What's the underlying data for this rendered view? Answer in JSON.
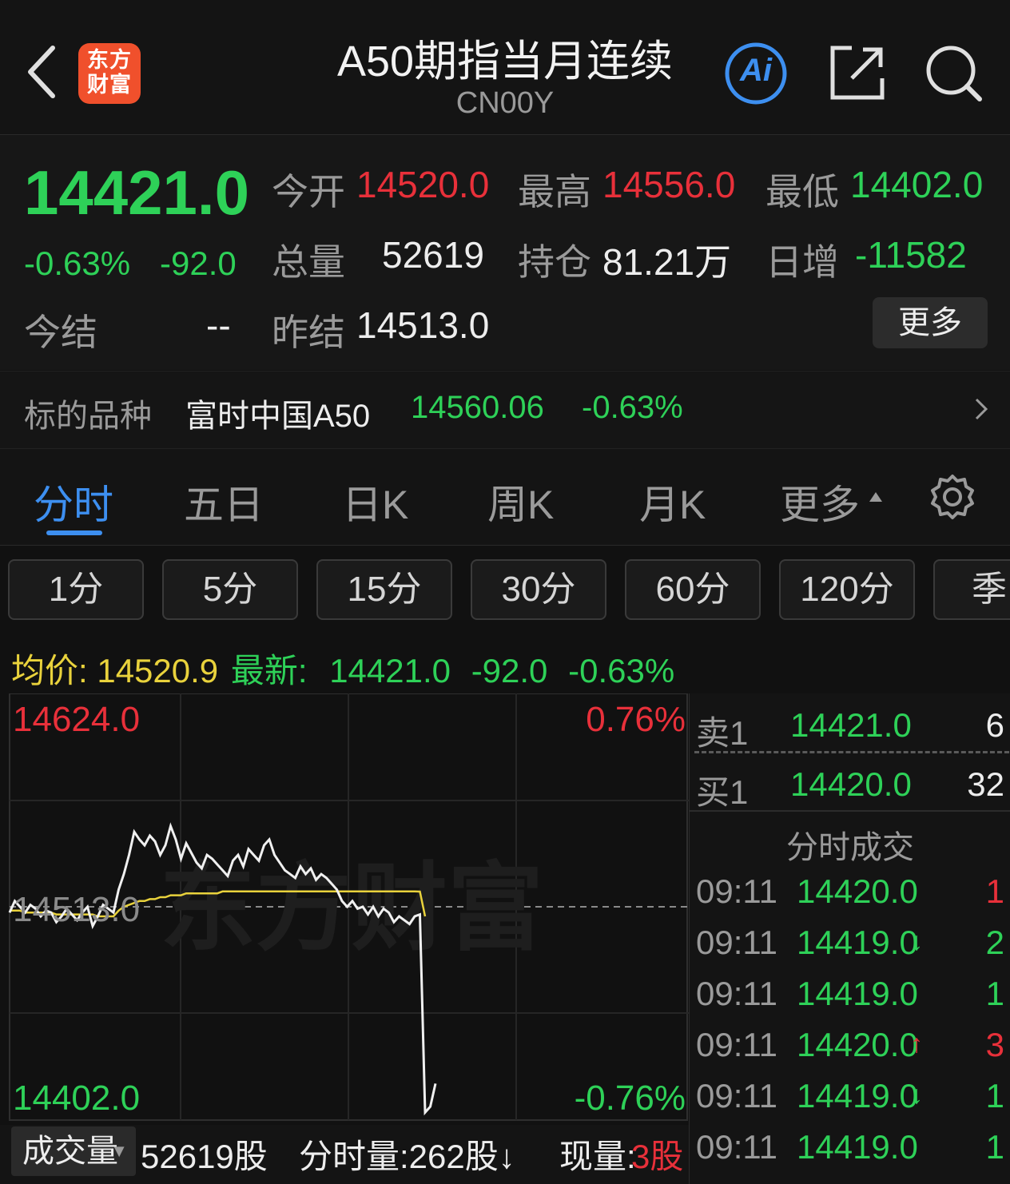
{
  "header": {
    "back": "‹",
    "logo_text": "东方财富",
    "title": "A50期指当月连续",
    "code": "CN00Y",
    "ai_label": "Ai"
  },
  "quote": {
    "last": "14421.0",
    "change_pct": "-0.63%",
    "change": "-92.0",
    "open_label": "今开",
    "open": "14520.0",
    "high_label": "最高",
    "high": "14556.0",
    "low_label": "最低",
    "low": "14402.0",
    "volume_label": "总量",
    "volume": "52619",
    "oi_label": "持仓",
    "oi": "81.21万",
    "oi_change_label": "日增",
    "oi_change": "-11582",
    "settle_label": "今结",
    "settle": "--",
    "prev_settle_label": "昨结",
    "prev_settle": "14513.0",
    "more": "更多"
  },
  "underlying": {
    "label": "标的品种",
    "name": "富时中国A50",
    "price": "14560.06",
    "change_pct": "-0.63%"
  },
  "tabs": [
    "分时",
    "五日",
    "日K",
    "周K",
    "月K",
    "更多"
  ],
  "periods": [
    "1分",
    "5分",
    "15分",
    "30分",
    "60分",
    "120分",
    "季"
  ],
  "infoline": {
    "avg_label": "均价:",
    "avg": "14520.9",
    "latest_label": "最新:",
    "latest": "14421.0",
    "change": "-92.0",
    "change_pct": "-0.63%"
  },
  "chart_data": {
    "type": "line",
    "y_max_label": "14624.0",
    "y_min_label": "14402.0",
    "y_prev_label": "14513.0",
    "pct_max_label": "0.76%",
    "pct_min_label": "-0.76%",
    "watermark": "东方财富",
    "ylim": [
      14402.0,
      14624.0
    ],
    "prev_close": 14513.0,
    "price": [
      14510,
      14516,
      14513,
      14510,
      14514,
      14512,
      14508,
      14511,
      14510,
      14505,
      14508,
      14512,
      14509,
      14506,
      14510,
      14513,
      14503,
      14508,
      14514,
      14512,
      14510,
      14522,
      14530,
      14540,
      14552,
      14548,
      14545,
      14550,
      14547,
      14540,
      14545,
      14555,
      14548,
      14538,
      14546,
      14541,
      14536,
      14533,
      14540,
      14538,
      14535,
      14532,
      14529,
      14537,
      14540,
      14534,
      14543,
      14540,
      14537,
      14545,
      14548,
      14540,
      14536,
      14532,
      14530,
      14528,
      14534,
      14530,
      14533,
      14527,
      14530,
      14528,
      14525,
      14522,
      14516,
      14513,
      14516,
      14512,
      14513,
      14509,
      14513,
      14508,
      14512,
      14510,
      14505,
      14508,
      14506,
      14504,
      14508,
      14509,
      14406,
      14409,
      14421
    ],
    "avg": [
      14511,
      14511,
      14511,
      14510,
      14510,
      14510,
      14510,
      14510,
      14510,
      14509,
      14509,
      14509,
      14509,
      14509,
      14509,
      14509,
      14509,
      14508,
      14508,
      14508,
      14508,
      14511,
      14513,
      14514,
      14515,
      14516,
      14516,
      14517,
      14517,
      14518,
      14518,
      14519,
      14519,
      14519,
      14520,
      14520,
      14520,
      14520,
      14520,
      14520,
      14520,
      14521,
      14521,
      14521,
      14521,
      14521,
      14521,
      14521,
      14521,
      14521,
      14521,
      14521,
      14521,
      14521,
      14521,
      14521,
      14521,
      14521,
      14521,
      14521,
      14521,
      14521,
      14521,
      14521,
      14521,
      14521,
      14521,
      14521,
      14521,
      14521,
      14521,
      14521,
      14521,
      14521,
      14521,
      14521,
      14521,
      14521,
      14521,
      14520.9,
      14508
    ]
  },
  "orderbook": {
    "ask_label": "卖1",
    "ask_price": "14421.0",
    "ask_qty": "6",
    "bid_label": "买1",
    "bid_price": "14420.0",
    "bid_qty": "32",
    "ticks_title": "分时成交",
    "ticks": [
      {
        "time": "09:11",
        "price": "14420.0",
        "arrow": "",
        "qty": "1",
        "qty_color": "#e8303a"
      },
      {
        "time": "09:11",
        "price": "14419.0",
        "arrow": "↓",
        "qty": "2",
        "qty_color": "#2ed158"
      },
      {
        "time": "09:11",
        "price": "14419.0",
        "arrow": "",
        "qty": "1",
        "qty_color": "#2ed158"
      },
      {
        "time": "09:11",
        "price": "14420.0",
        "arrow": "↑",
        "qty": "3",
        "qty_color": "#e8303a"
      },
      {
        "time": "09:11",
        "price": "14419.0",
        "arrow": "↓",
        "qty": "1",
        "qty_color": "#2ed158"
      },
      {
        "time": "09:11",
        "price": "14419.0",
        "arrow": "",
        "qty": "1",
        "qty_color": "#2ed158"
      }
    ]
  },
  "volume": {
    "select_label": "成交量",
    "total": "52619股",
    "tick_vol": "分时量:262股↓",
    "cur_label": "现量:",
    "cur_value": "3股"
  },
  "colors": {
    "up": "#e8303a",
    "down": "#2ed158",
    "accent": "#3d8ff0",
    "avg_line": "#e9d23c"
  }
}
